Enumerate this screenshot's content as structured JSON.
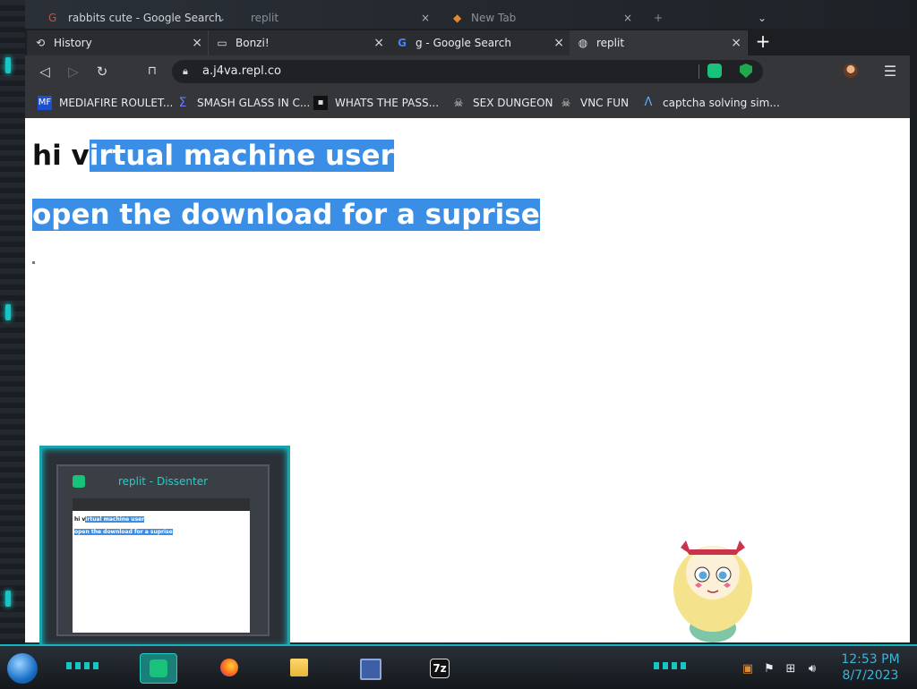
{
  "background_tabs": [
    {
      "title": "rabbits cute - Google Search"
    },
    {
      "title": "replit"
    },
    {
      "title": "New Tab"
    }
  ],
  "browser": {
    "tabs": [
      {
        "title": "History",
        "icon": "history-icon",
        "active": false
      },
      {
        "title": "Bonzi!",
        "icon": "page-icon",
        "active": false
      },
      {
        "title": "g - Google Search",
        "icon": "google-icon",
        "active": false
      },
      {
        "title": "replit",
        "icon": "globe-icon",
        "active": true
      }
    ],
    "address": "a.j4va.repl.co",
    "bookmarks": [
      {
        "label": "MEDIAFIRE ROULET...",
        "icon": "mediafire-icon"
      },
      {
        "label": "SMASH GLASS IN C...",
        "icon": "sigma-icon"
      },
      {
        "label": "WHATS THE PASS...",
        "icon": "terminal-icon"
      },
      {
        "label": "SEX DUNGEON",
        "icon": "skull-icon"
      },
      {
        "label": "VNC FUN",
        "icon": "skull-icon"
      },
      {
        "label": "captcha solving sim...",
        "icon": "lambda-icon"
      }
    ]
  },
  "page": {
    "line1_plain": "hi v",
    "line1_selected": "irtual machine user ",
    "line2_selected": "open the download for a suprise"
  },
  "preview": {
    "title": "replit - Dissenter",
    "line1_plain": "hi v",
    "line1_selected": "irtual machine user",
    "line2_selected": "open the download for a suprise"
  },
  "taskbar": {
    "apps": [
      {
        "name": "dissenter",
        "active": true
      },
      {
        "name": "firefox",
        "active": false
      },
      {
        "name": "file-explorer",
        "active": false
      },
      {
        "name": "control-panel",
        "active": false
      },
      {
        "name": "7zip",
        "active": false,
        "label": "7z"
      }
    ],
    "time": "12:53 PM",
    "date": "8/7/2023"
  },
  "colors": {
    "selection": "#3a8ee6",
    "accent_cyan": "#17c5c2",
    "clock": "#3cb4d8"
  }
}
